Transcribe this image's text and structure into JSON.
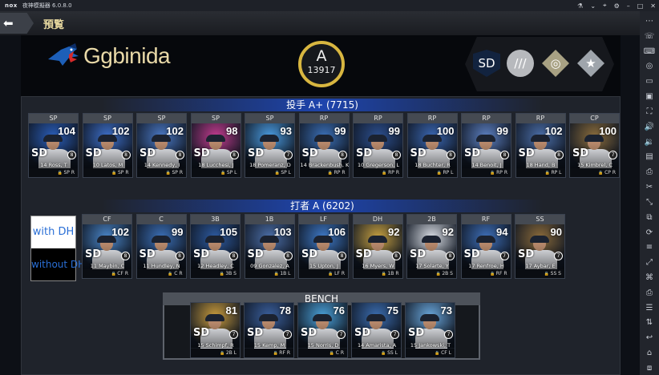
{
  "window": {
    "logo_text": "nox",
    "title": "夜神模擬器 6.0.8.0",
    "controls": [
      "⚗",
      "⌄",
      "⌖",
      "⚙",
      "–",
      "□",
      "✕"
    ]
  },
  "sidebar_icons": [
    "more-icon",
    "phone-icon",
    "keyboard-icon",
    "location-icon",
    "screen-icon",
    "fullscreen-icon",
    "expand-icon",
    "volume-up-icon",
    "volume-down-icon",
    "apk-icon",
    "screenshot-icon",
    "cut-icon",
    "scale-icon",
    "multi-icon",
    "sync-icon",
    "menu-icon",
    "resize-icon",
    "macro-icon",
    "printer-icon",
    "list-icon",
    "shake-icon",
    "back-icon",
    "home-icon",
    "recent-icon"
  ],
  "topbar": {
    "back_glyph": "⬅",
    "page_title": "預覧"
  },
  "team": {
    "name": "Ggbinida",
    "grade": "A",
    "overall": "13917"
  },
  "badges": [
    {
      "icon": "padres-team-badge-icon",
      "glyph": "SD",
      "color": "#12233f"
    },
    {
      "icon": "silver-badge-icon",
      "glyph": "///",
      "color": "#b7b9bd"
    },
    {
      "icon": "target-badge-icon",
      "glyph": "◎",
      "color": "#a8a183"
    },
    {
      "icon": "star-badge-icon",
      "glyph": "★",
      "color": "#9fa5ac"
    }
  ],
  "pitchers_header": "投手 A+ (7715)",
  "batters_header": "打者 A (6202)",
  "bench_header": "BENCH",
  "dh": {
    "with": "with DH",
    "without": "without DH"
  },
  "pitchers": [
    {
      "pos": "SP",
      "ovr": "104",
      "lvl": "8",
      "name": "14 Ross, T",
      "foot": "SP R",
      "art": "#2a5db8"
    },
    {
      "pos": "SP",
      "ovr": "102",
      "lvl": "8",
      "name": "10 Latos, M",
      "foot": "SP R",
      "art": "#3d6fc9"
    },
    {
      "pos": "SP",
      "ovr": "102",
      "lvl": "8",
      "name": "14 Kennedy, I",
      "foot": "SP R",
      "art": "#4a78c4"
    },
    {
      "pos": "SP",
      "ovr": "98",
      "lvl": "8",
      "name": "18 Lucchesi, J",
      "foot": "SP L",
      "art": "#c23b8e"
    },
    {
      "pos": "SP",
      "ovr": "93",
      "lvl": "7",
      "name": "18 Pomeranz, D",
      "foot": "SP L",
      "art": "#4a9be0"
    },
    {
      "pos": "RP",
      "ovr": "99",
      "lvl": "8",
      "name": "14 Brackenbush, K",
      "foot": "RP R",
      "art": "#3b6fb6"
    },
    {
      "pos": "RP",
      "ovr": "99",
      "lvl": "8",
      "name": "10 Gregerson, L",
      "foot": "RP R",
      "art": "#2c4f8f"
    },
    {
      "pos": "RP",
      "ovr": "100",
      "lvl": "8",
      "name": "18 Buchter, R",
      "foot": "RP L",
      "art": "#3a66b1"
    },
    {
      "pos": "RP",
      "ovr": "99",
      "lvl": "8",
      "name": "14 Benoit, J",
      "foot": "RP R",
      "art": "#5c7fc0"
    },
    {
      "pos": "RP",
      "ovr": "102",
      "lvl": "8",
      "name": "18 Hand, B",
      "foot": "RP L",
      "art": "#4b6ea8"
    },
    {
      "pos": "CP",
      "ovr": "100",
      "lvl": "7",
      "name": "15 Kimbrel, C",
      "foot": "CP R",
      "art": "#8a6c3c"
    }
  ],
  "batters": [
    {
      "pos": "CF",
      "ovr": "102",
      "lvl": "8",
      "name": "11 Maybin, C",
      "foot": "CF R",
      "art": "#4a86c9"
    },
    {
      "pos": "C",
      "ovr": "99",
      "lvl": "8",
      "name": "11 Hundley, N",
      "foot": "C R",
      "art": "#3b6fb6"
    },
    {
      "pos": "3B",
      "ovr": "105",
      "lvl": "8",
      "name": "12 Headley, C",
      "foot": "3B S",
      "art": "#2d5aa0"
    },
    {
      "pos": "1B",
      "ovr": "103",
      "lvl": "8",
      "name": "09 Gonzalez, A",
      "foot": "1B L",
      "art": "#4c6fa8"
    },
    {
      "pos": "LF",
      "ovr": "106",
      "lvl": "8",
      "name": "15 Upton, J",
      "foot": "LF R",
      "art": "#3e79c7"
    },
    {
      "pos": "DH",
      "ovr": "92",
      "lvl": "8",
      "name": "16 Myers, W",
      "foot": "1B R",
      "art": "#c6a040"
    },
    {
      "pos": "2B",
      "ovr": "92",
      "lvl": "8",
      "name": "17 Solarte, Y",
      "foot": "2B S",
      "art": "#d9dde4"
    },
    {
      "pos": "RF",
      "ovr": "94",
      "lvl": "7",
      "name": "17 Renfroe, H",
      "foot": "RF R",
      "art": "#3e6fb8"
    },
    {
      "pos": "SS",
      "ovr": "90",
      "lvl": "7",
      "name": "17 Aybar, E",
      "foot": "SS S",
      "art": "#8a6a3a"
    }
  ],
  "bench": [
    {
      "ovr": "81",
      "lvl": "7",
      "name": "15 Schimpf, R",
      "foot": "2B L",
      "art": "#c79a3c"
    },
    {
      "ovr": "78",
      "lvl": "7",
      "name": "15 Kemp, M",
      "foot": "RF R",
      "art": "#3a5f9c"
    },
    {
      "ovr": "76",
      "lvl": "7",
      "name": "15 Norris, D",
      "foot": "C R",
      "art": "#4aa0d8"
    },
    {
      "ovr": "75",
      "lvl": "7",
      "name": "14 Amarista, A",
      "foot": "SS L",
      "art": "#3b6db0"
    },
    {
      "ovr": "73",
      "lvl": "7",
      "name": "15 Jankowski, T",
      "foot": "CF L",
      "art": "#6aa7dc"
    }
  ]
}
